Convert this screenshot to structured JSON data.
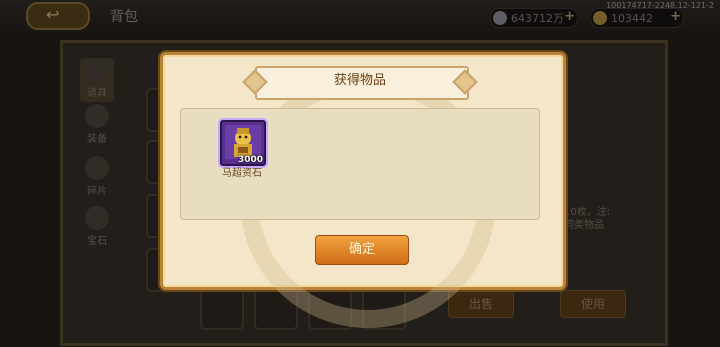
{
  "topbar": {
    "back_icon": "back-arrow-icon",
    "title": "背包",
    "silver": "643712万",
    "gold": "103442",
    "build_info": "100174717-2248.12-121-2"
  },
  "sidebar": {
    "tabs": [
      {
        "label": "道具",
        "icon": "item-bag-icon"
      },
      {
        "label": "装备",
        "icon": "equipment-icon"
      },
      {
        "label": "碎片",
        "icon": "fragment-icon"
      },
      {
        "label": "宝石",
        "icon": "gem-icon"
      }
    ]
  },
  "right_panel": {
    "desc": "石10枚，注:\n的同类物品"
  },
  "bottom_buttons": {
    "sell": "出售",
    "use": "使用"
  },
  "dialog": {
    "title": "获得物品",
    "item": {
      "name": "马超资石",
      "count": "3000",
      "rarity_color": "#5b2f8e"
    },
    "confirm": "确定"
  },
  "colors": {
    "accent": "#cf6d17",
    "dialog_bg": "#f4e6c8",
    "title_text": "#6b3f14"
  }
}
